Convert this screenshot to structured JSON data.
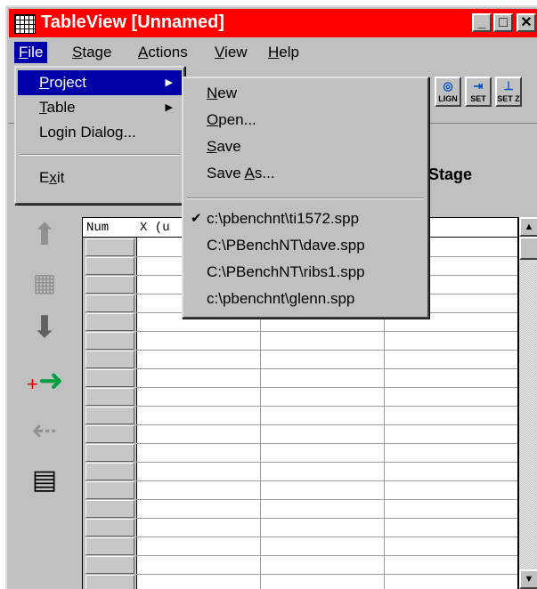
{
  "window": {
    "title": "TableView [Unnamed]",
    "caption_buttons": {
      "minimize": "_",
      "maximize": "□",
      "close": "✕"
    }
  },
  "menubar": {
    "items": [
      {
        "label": "File",
        "mnemonic": "F",
        "rest": "ile",
        "active": true
      },
      {
        "label": "Stage",
        "mnemonic": "S",
        "rest": "tage"
      },
      {
        "label": "Actions",
        "mnemonic": "A",
        "rest": "ctions"
      },
      {
        "label": "View",
        "mnemonic": "V",
        "rest": "iew"
      },
      {
        "label": "Help",
        "mnemonic": "H",
        "rest": "elp"
      }
    ]
  },
  "file_menu": {
    "items": [
      {
        "label": "Project",
        "mnemonic": "P",
        "rest": "roject",
        "submenu": true,
        "highlighted": true
      },
      {
        "label": "Table",
        "mnemonic": "T",
        "rest": "able",
        "submenu": true
      },
      {
        "label": "Login Dialog..."
      },
      {
        "label": "Exit",
        "pre": "E",
        "mnemonic": "x",
        "rest": "it"
      }
    ]
  },
  "project_submenu": {
    "items": [
      {
        "label": "New",
        "mnemonic": "N",
        "rest": "ew"
      },
      {
        "label": "Open...",
        "mnemonic": "O",
        "rest": "pen..."
      },
      {
        "label": "Save",
        "mnemonic": "S",
        "rest": "ave"
      },
      {
        "label": "Save As...",
        "pre": "Save ",
        "mnemonic": "A",
        "rest": "s..."
      }
    ],
    "recent_files": [
      {
        "label": "c:\\pbenchnt\\ti1572.spp",
        "checked": true
      },
      {
        "label": "C:\\PBenchNT\\dave.spp"
      },
      {
        "label": "C:\\PBenchNT\\ribs1.spp"
      },
      {
        "label": "c:\\pbenchnt\\glenn.spp"
      }
    ],
    "check_glyph": "✔",
    "arrow_glyph": "▶"
  },
  "toolbar": {
    "buttons": [
      {
        "label": "LIGN",
        "icon": "align-icon"
      },
      {
        "label": "SET",
        "icon": "set-icon"
      },
      {
        "label": "SET Z",
        "icon": "set-z-icon"
      }
    ]
  },
  "stage_label": "k Stage",
  "table": {
    "columns": [
      "Num",
      "X  (u"
    ],
    "row_count": 20
  },
  "scrollbar": {
    "up": "▲",
    "down": "▼"
  }
}
